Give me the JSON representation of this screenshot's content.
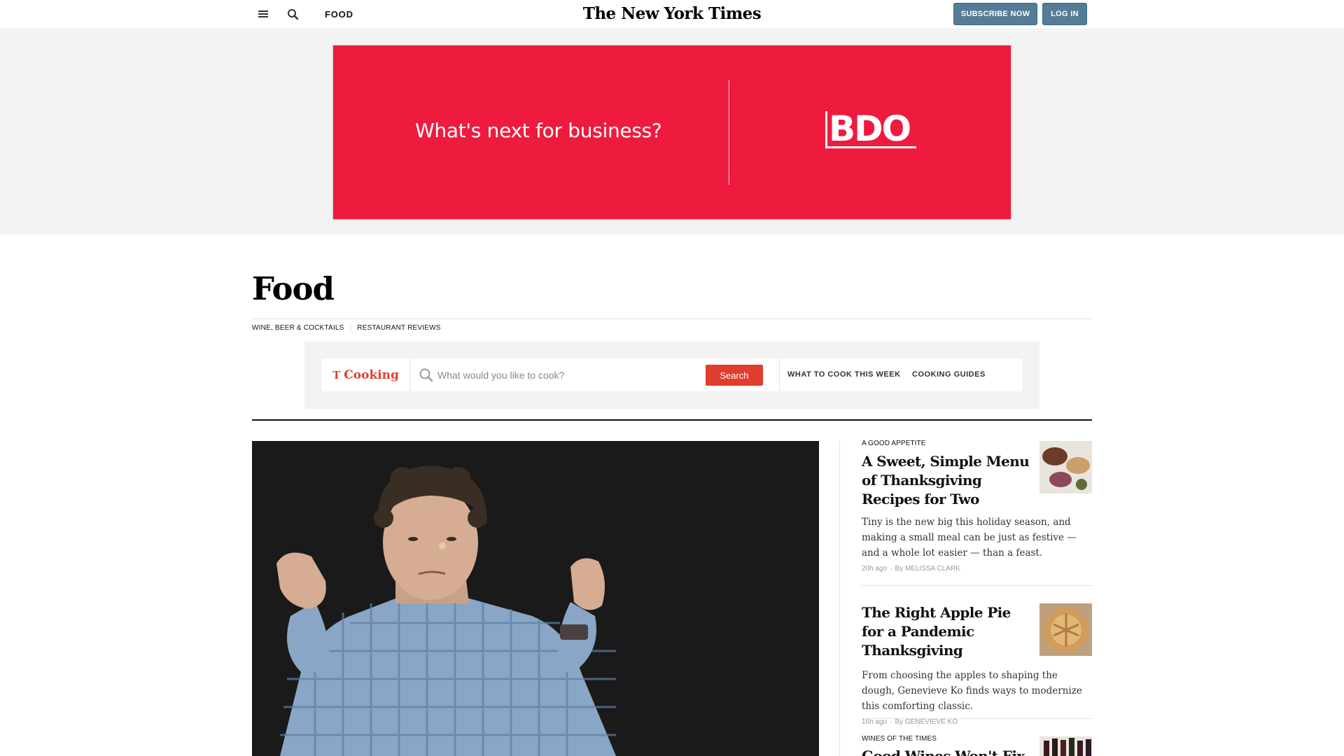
{
  "header": {
    "section": "FOOD",
    "logo": "The New York Times",
    "subscribe_label": "SUBSCRIBE NOW",
    "login_label": "LOG IN"
  },
  "ad": {
    "tagline": "What's next for business?",
    "brand": "BDO",
    "background_color": "#ef1b3f"
  },
  "page": {
    "title": "Food",
    "subnav": [
      "WINE, BEER & COCKTAILS",
      "RESTAURANT REVIEWS"
    ]
  },
  "cooking": {
    "logo_glyph": "T",
    "logo_text": "Cooking",
    "search_placeholder": "What would you like to cook?",
    "search_button": "Search",
    "links": [
      "WHAT TO COOK THIS WEEK",
      "COOKING GUIDES"
    ],
    "accent_color": "#e03e2d"
  },
  "stories": [
    {
      "kicker": "A GOOD APPETITE",
      "headline": "A Sweet, Simple Menu of Thanksgiving Recipes for Two",
      "summary": "Tiny is the new big this holiday season, and making a small meal can be just as festive — and a whole lot easier — than a feast.",
      "time": "20h ago",
      "byline": "By MELISSA CLARK"
    },
    {
      "kicker": "",
      "headline": "The Right Apple Pie for a Pandemic Thanksgiving",
      "summary": "From choosing the apples to shaping the dough, Genevieve Ko finds ways to modernize this comforting classic.",
      "time": "16h ago",
      "byline": "By GENEVIEVE KO"
    },
    {
      "kicker": "WINES OF THE TIMES",
      "headline": "Good Wines Won't Fix",
      "summary": "",
      "time": "",
      "byline": ""
    }
  ]
}
